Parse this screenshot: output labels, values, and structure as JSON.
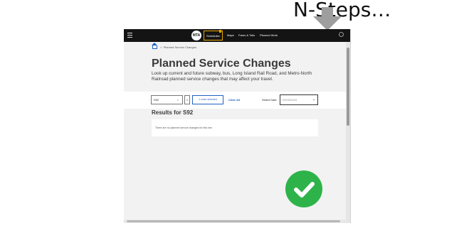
{
  "slide": {
    "title": "N-Steps…"
  },
  "nav": {
    "logo_text": "MTA",
    "items": [
      "Schedules",
      "Maps",
      "Fares & Tolls",
      "Planned Work"
    ],
    "icons": [
      "hamburger-icon",
      "search-icon"
    ]
  },
  "breadcrumb": {
    "current": "Planned Service Changes"
  },
  "page": {
    "title": "Planned Service Changes",
    "description": "Look up current and future subway, bus, Long Island Rail Road, and Metro-North Railroad planned service changes that may affect your travel."
  },
  "filters": {
    "route_value": "S92",
    "route_clear": "×",
    "route_toggle": "∨",
    "routes_selected": "1 route selected",
    "clear_all": "Clear All",
    "date_label": "Select Date",
    "date_value": "03/20/2024"
  },
  "results": {
    "title": "Results for S92",
    "message": "There are no planned service changes for this line."
  },
  "colors": {
    "nav_bg": "#141414",
    "accent": "#2060c0",
    "highlight": "#e8a800",
    "success": "#2eb34a",
    "arrow": "#9e9e9e"
  }
}
